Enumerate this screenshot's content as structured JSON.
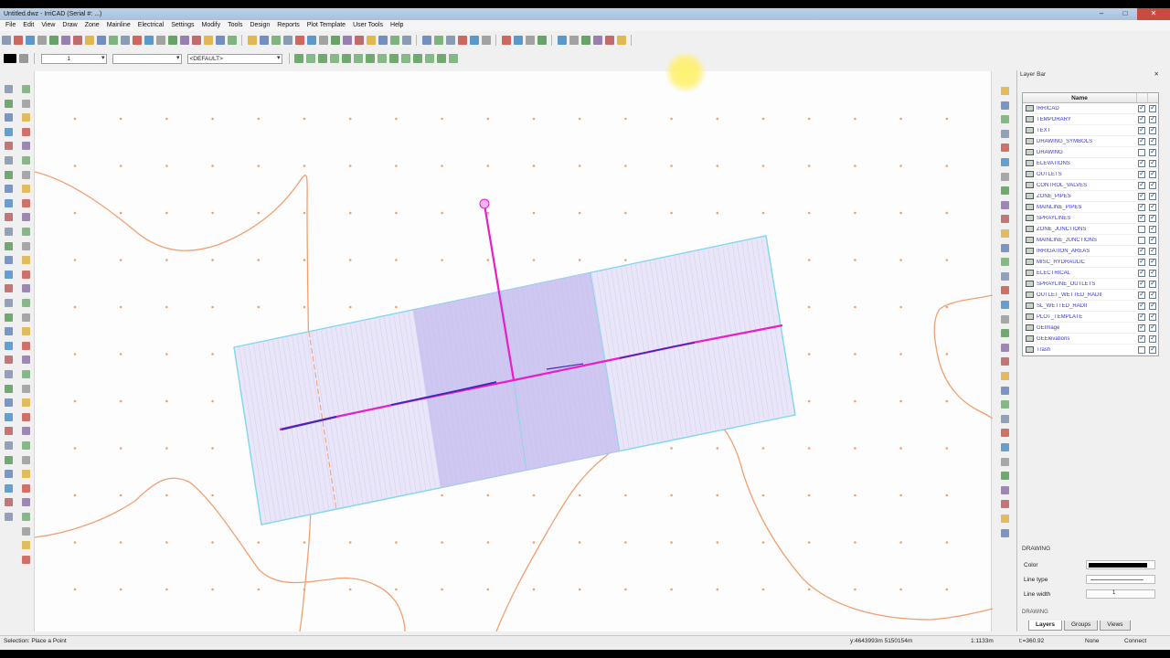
{
  "app": {
    "title": "Untitled.dwz - IrriCAD (Serial #: ...)",
    "window_buttons": [
      "–",
      "□",
      "✕"
    ]
  },
  "menu": [
    "File",
    "Edit",
    "View",
    "Draw",
    "Zone",
    "Mainline",
    "Electrical",
    "Settings",
    "Modify",
    "Tools",
    "Design",
    "Reports",
    "Plot Template",
    "User Tools",
    "Help"
  ],
  "toolbar": {
    "line_width_value": "1",
    "layer_combo": "<DEFAULT>",
    "icon_colors": [
      "#6b7fa0",
      "#d9a520",
      "#3a8a3a",
      "#c23b2e",
      "#4a6fb0",
      "#7a5a9a",
      "#2b7bbf",
      "#5aa05a",
      "#b04040",
      "#888"
    ]
  },
  "layer_bar": {
    "title": "Layer Bar",
    "close_icon": "✕",
    "columns": [
      "Name"
    ],
    "layers": [
      {
        "name": "IRRICAD",
        "visible": true,
        "locked": true
      },
      {
        "name": "TEMPORARY",
        "visible": true,
        "locked": true
      },
      {
        "name": "TEXT",
        "visible": true,
        "locked": true
      },
      {
        "name": "DRAWING_SYMBOLS",
        "visible": true,
        "locked": true
      },
      {
        "name": "DRAWING",
        "visible": false,
        "locked": true
      },
      {
        "name": "ELEVATIONS",
        "visible": true,
        "locked": true
      },
      {
        "name": "OUTLETS",
        "visible": true,
        "locked": true
      },
      {
        "name": "CONTROL_VALVES",
        "visible": true,
        "locked": true
      },
      {
        "name": "ZONE_PIPES",
        "visible": true,
        "locked": true
      },
      {
        "name": "MAINLINE_PIPES",
        "visible": true,
        "locked": true
      },
      {
        "name": "SPRAYLINES",
        "visible": true,
        "locked": true
      },
      {
        "name": "ZONE_JUNCTIONS",
        "visible": false,
        "locked": true
      },
      {
        "name": "MAINLINE_JUNCTIONS",
        "visible": false,
        "locked": true
      },
      {
        "name": "IRRIGATION_AREAS",
        "visible": true,
        "locked": true
      },
      {
        "name": "MISC_HYDRAULIC",
        "visible": true,
        "locked": true
      },
      {
        "name": "ELECTRICAL",
        "visible": true,
        "locked": true
      },
      {
        "name": "SPRAYLINE_OUTLETS",
        "visible": true,
        "locked": true
      },
      {
        "name": "OUTLET_WETTED_RADII",
        "visible": true,
        "locked": true
      },
      {
        "name": "SL_WETTED_RADII",
        "visible": true,
        "locked": true
      },
      {
        "name": "PLOT_TEMPLATE",
        "visible": true,
        "locked": true
      },
      {
        "name": "GEImage",
        "visible": true,
        "locked": true
      },
      {
        "name": "GEElevations",
        "visible": true,
        "locked": true
      },
      {
        "name": "Trash",
        "visible": false,
        "locked": true
      }
    ],
    "selected_group": "DRAWING",
    "props": {
      "color_label": "Color",
      "linetype_label": "Line type",
      "linewidth_label": "Line width",
      "linewidth_value": "1"
    },
    "footer_layer": "DRAWING",
    "tabs": [
      "Layers",
      "Groups",
      "Views"
    ]
  },
  "status": {
    "prompt": "Selection: Place a Point",
    "coords": "y:4643993m   5150154m",
    "scale": "1:1133m",
    "snap": "None",
    "angle": "t:=360.92",
    "mode": "Connect"
  },
  "colors": {
    "pipe_magenta": "#e81ec8",
    "pipe_blue": "#3a2bb8",
    "area_fill": "#e8e6f8",
    "area_dark": "#c8c0f0",
    "area_border": "#7fd6ee",
    "contour": "#f0a070",
    "grid_dot": "#f0a070"
  }
}
